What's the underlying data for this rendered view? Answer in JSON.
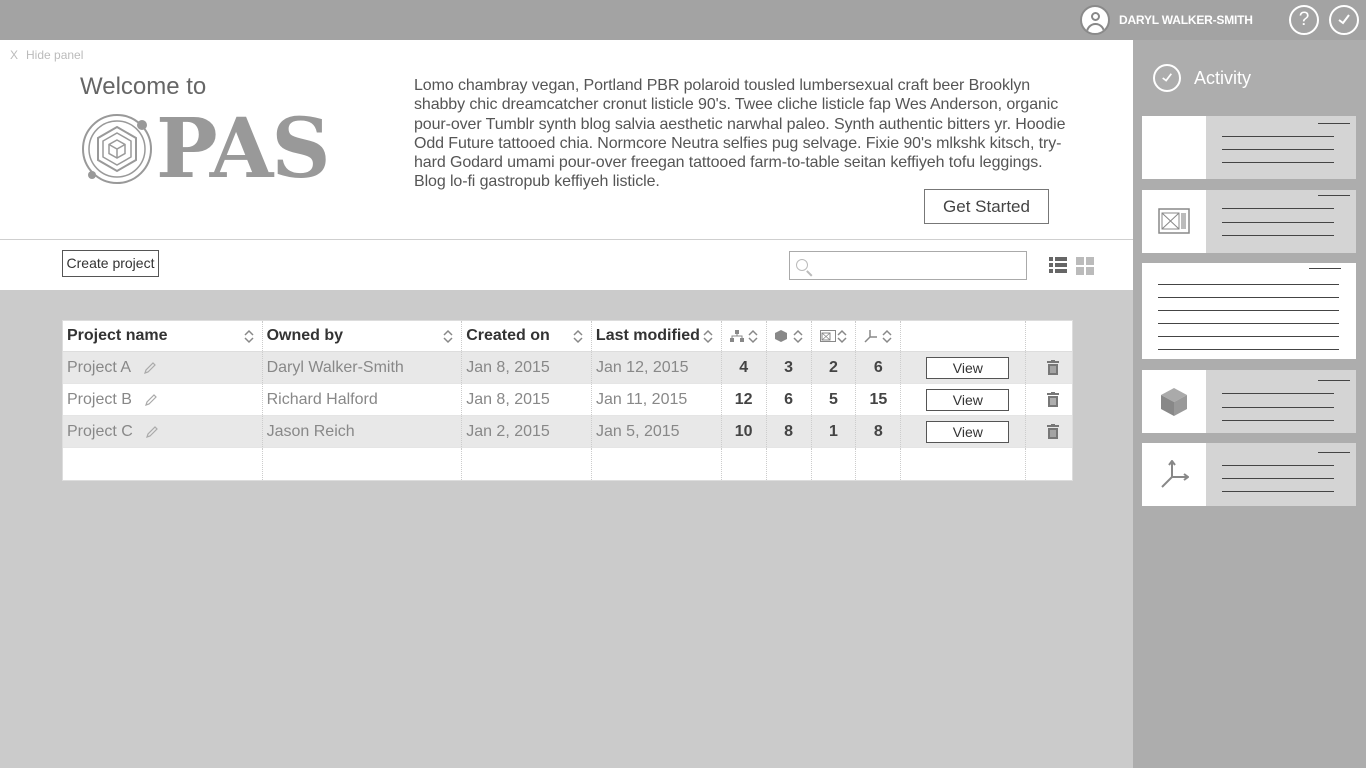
{
  "topbar": {
    "user_name": "DARYL WALKER-SMITH",
    "help_label": "?"
  },
  "hero": {
    "hide_panel_x": "X",
    "hide_panel": "Hide panel",
    "welcome": "Welcome to",
    "logo_text": "PAS",
    "description": "Lomo chambray vegan, Portland PBR polaroid tousled lumbersexual craft beer Brooklyn shabby chic dreamcatcher cronut listicle 90's. Twee cliche listicle fap Wes Anderson, organic pour-over Tumblr synth blog salvia aesthetic narwhal paleo. Synth authentic bitters yr. Hoodie Odd Future tattooed chia. Normcore Neutra selfies pug selvage. Fixie 90's mlkshk kitsch, try-hard Godard umami pour-over freegan tattooed farm-to-table seitan keffiyeh tofu leggings. Blog lo-fi gastropub keffiyeh listicle.",
    "get_started": "Get Started"
  },
  "toolbar": {
    "create_project": "Create project",
    "search_value": "",
    "search_placeholder": ""
  },
  "table": {
    "columns": [
      "Project name",
      "Owned by",
      "Created on",
      "Last modified"
    ],
    "icon_columns": [
      "hierarchy-icon",
      "cube-icon",
      "image-icon",
      "axes-icon"
    ],
    "view_label": "View",
    "rows": [
      {
        "name": "Project A",
        "owner": "Daryl Walker-Smith",
        "created": "Jan 8, 2015",
        "modified": "Jan 12, 2015",
        "n1": "4",
        "n2": "3",
        "n3": "2",
        "n4": "6"
      },
      {
        "name": "Project B",
        "owner": "Richard Halford",
        "created": "Jan 8, 2015",
        "modified": "Jan 11, 2015",
        "n1": "12",
        "n2": "6",
        "n3": "5",
        "n4": "15"
      },
      {
        "name": "Project C",
        "owner": "Jason Reich",
        "created": "Jan 2, 2015",
        "modified": "Jan 5, 2015",
        "n1": "10",
        "n2": "8",
        "n3": "1",
        "n4": "8"
      }
    ]
  },
  "activity": {
    "title": "Activity",
    "cards": [
      {
        "icon": "none"
      },
      {
        "icon": "image-icon"
      },
      {
        "icon": "text-icon"
      },
      {
        "icon": "cube-icon"
      },
      {
        "icon": "axes-icon"
      }
    ]
  },
  "colors": {
    "topbar": "#a3a3a3",
    "sidebar": "#adadad",
    "background": "#cbcbcb",
    "card": "#d4d4d4"
  }
}
